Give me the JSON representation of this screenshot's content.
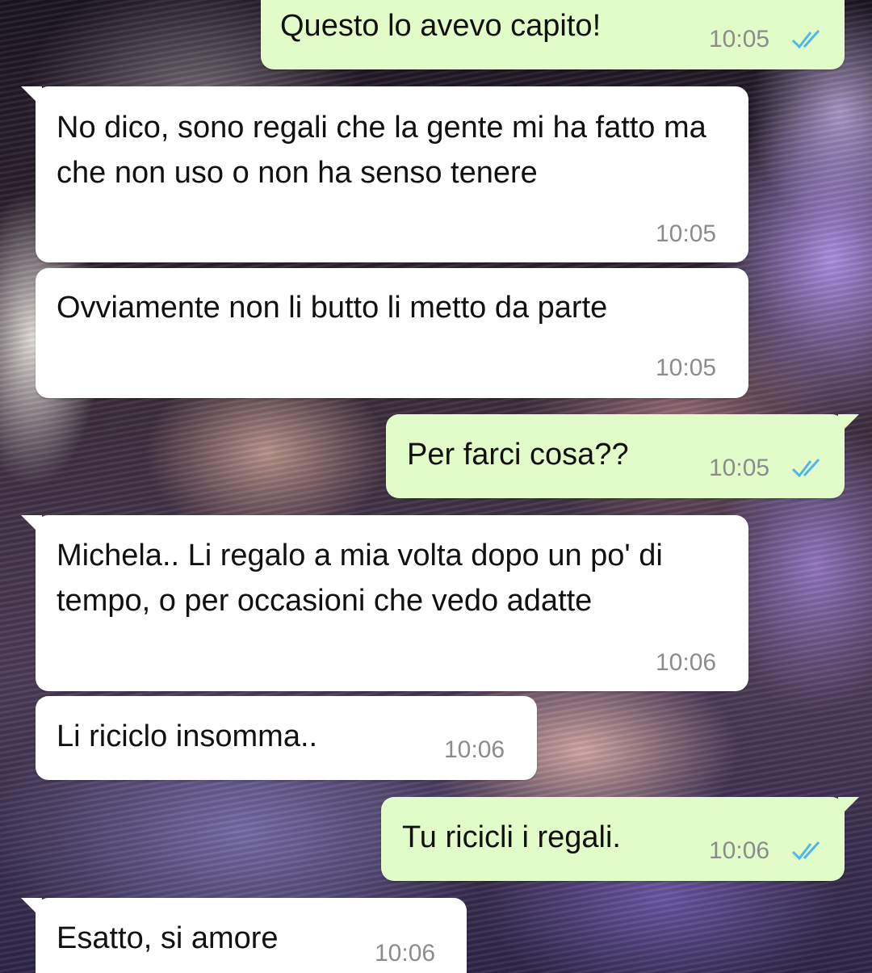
{
  "messages": [
    {
      "direction": "outgoing",
      "text": "Questo lo avevo capito!",
      "time": "10:05",
      "status": "read"
    },
    {
      "direction": "incoming",
      "text": "No dico, sono regali che la gente mi ha fatto ma che non uso o non ha senso tenere",
      "time": "10:05"
    },
    {
      "direction": "incoming",
      "text": "Ovviamente non li butto li metto da parte",
      "time": "10:05"
    },
    {
      "direction": "outgoing",
      "text": "Per farci cosa??",
      "time": "10:05",
      "status": "read"
    },
    {
      "direction": "incoming",
      "text": "Michela.. Li regalo a mia volta dopo un po' di tempo, o per occasioni che vedo adatte",
      "time": "10:06"
    },
    {
      "direction": "incoming",
      "text": "Li riciclo insomma..",
      "time": "10:06"
    },
    {
      "direction": "outgoing",
      "text": "Tu ricicli i regali.",
      "time": "10:06",
      "status": "read"
    },
    {
      "direction": "incoming",
      "text": "Esatto, si amore",
      "time": "10:06"
    }
  ],
  "colors": {
    "incoming_bubble": "#ffffff",
    "outgoing_bubble": "#e1fcc9",
    "timestamp": "#8c8c8c",
    "read_ticks": "#4fb6ec"
  },
  "icons": {
    "read_receipt": "double-check-icon"
  }
}
